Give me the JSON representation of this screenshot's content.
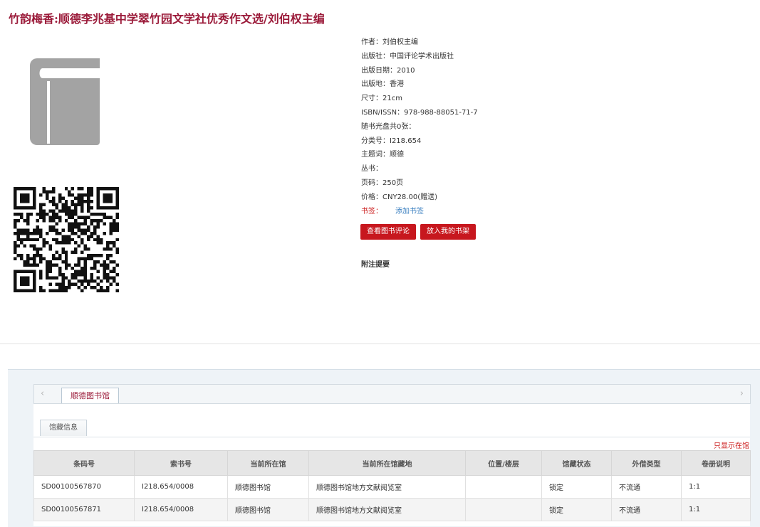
{
  "title": "竹韵梅香:顺德李兆基中学翠竹园文学社优秀作文选/刘伯权主编",
  "icons": {
    "cover": "book-icon",
    "qr": "qr-code-icon",
    "arrow_left": "chevron-left-icon",
    "arrow_right": "chevron-right-icon"
  },
  "meta": {
    "author": "作者：刘伯权主编",
    "publisher": "出版社：中国评论学术出版社",
    "pub_date": "出版日期：2010",
    "pub_place": "出版地：香港",
    "size": "尺寸：21cm",
    "isbn": "ISBN/ISSN：978-988-88051-71-7",
    "discs": "随书光盘共0张：",
    "class_no": "分类号：I218.654",
    "subject": "主题词：顺德",
    "series": "丛书：",
    "pages": "页码：250页",
    "price": "价格：CNY28.00(赠送)",
    "bookmark_label": "书签：",
    "bookmark_link": "添加书签"
  },
  "buttons": {
    "review": "查看图书评论",
    "shelf": "放入我的书架"
  },
  "notes_title": "附注提要",
  "tabs": {
    "library": "顺德图书馆",
    "holdings": "馆藏信息",
    "only_available": "只显示在馆"
  },
  "table": {
    "headers": [
      "条码号",
      "索书号",
      "当前所在馆",
      "当前所在馆藏地",
      "位置/楼层",
      "馆藏状态",
      "外借类型",
      "卷册说明"
    ],
    "rows": [
      [
        "SD00100567870",
        "I218.654/0008",
        "顺德图书馆",
        "顺德图书馆地方文献阅览室",
        "",
        "锁定",
        "不流通",
        "1:1"
      ],
      [
        "SD00100567871",
        "I218.654/0008",
        "顺德图书馆",
        "顺德图书馆地方文献阅览室",
        "",
        "锁定",
        "不流通",
        "1:1"
      ]
    ]
  },
  "colors": {
    "title": "#9b1b3a",
    "button": "#c7171e",
    "link": "#3a7fc0",
    "alert": "#cc1f1f",
    "icon_gray": "#a3a3a3"
  }
}
